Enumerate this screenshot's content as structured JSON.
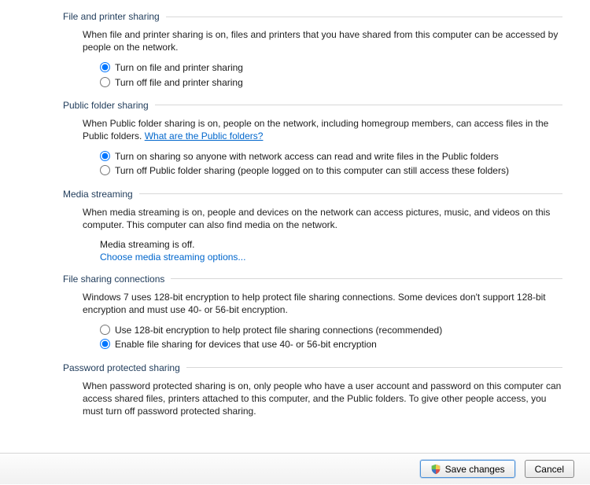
{
  "sections": {
    "filePrinter": {
      "title": "File and printer sharing",
      "desc": "When file and printer sharing is on, files and printers that you have shared from this computer can be accessed by people on the network.",
      "optOn": "Turn on file and printer sharing",
      "optOff": "Turn off file and printer sharing"
    },
    "publicFolder": {
      "title": "Public folder sharing",
      "descPrefix": "When Public folder sharing is on, people on the network, including homegroup members, can access files in the Public folders. ",
      "descLink": "What are the Public folders?",
      "optOn": "Turn on sharing so anyone with network access can read and write files in the Public folders",
      "optOff": "Turn off Public folder sharing (people logged on to this computer can still access these folders)"
    },
    "mediaStreaming": {
      "title": "Media streaming",
      "desc": "When media streaming is on, people and devices on the network can access pictures, music, and videos on this computer. This computer can also find media on the network.",
      "status": "Media streaming is off.",
      "link": "Choose media streaming options..."
    },
    "fileSharingConn": {
      "title": "File sharing connections",
      "desc": "Windows 7 uses 128-bit encryption to help protect file sharing connections. Some devices don't support 128-bit encryption and must use 40- or 56-bit encryption.",
      "opt128": "Use 128-bit encryption to help protect file sharing connections (recommended)",
      "opt40": "Enable file sharing for devices that use 40- or 56-bit encryption"
    },
    "passwordProtected": {
      "title": "Password protected sharing",
      "desc": "When password protected sharing is on, only people who have a user account and password on this computer can access shared files, printers attached to this computer, and the Public folders. To give other people access, you must turn off password protected sharing."
    }
  },
  "footer": {
    "save": "Save changes",
    "cancel": "Cancel"
  }
}
